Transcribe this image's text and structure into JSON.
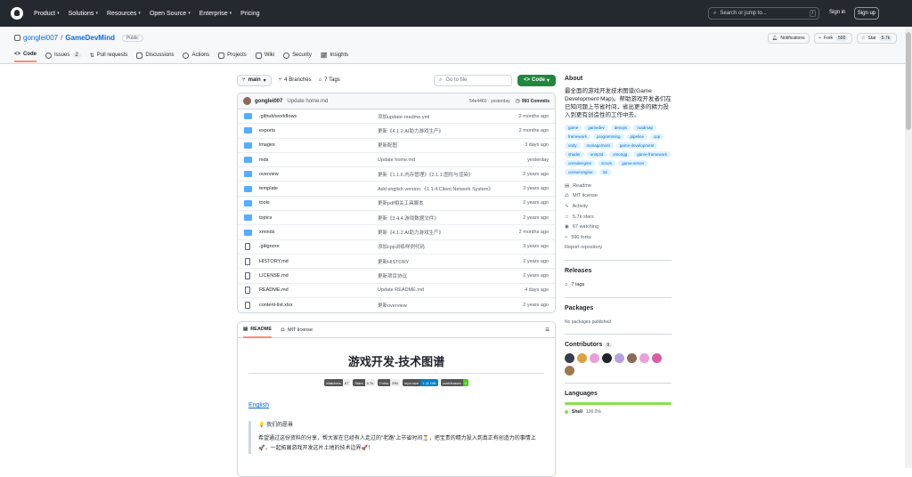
{
  "nav": {
    "items": [
      "Product",
      "Solutions",
      "Resources",
      "Open Source",
      "Enterprise",
      "Pricing"
    ],
    "search_placeholder": "Search or jump to...",
    "search_kbd": "/",
    "signin": "Sign in",
    "signup": "Sign up"
  },
  "repo": {
    "owner": "gonglei007",
    "sep": "/",
    "name": "GameDevMind",
    "visibility": "Public",
    "notifications": "Notifications",
    "fork_label": "Fork",
    "fork_count": "590",
    "star_label": "Star",
    "star_count": "5.7k"
  },
  "tabs": [
    {
      "label": "Code"
    },
    {
      "label": "Issues",
      "count": "2"
    },
    {
      "label": "Pull requests"
    },
    {
      "label": "Discussions"
    },
    {
      "label": "Actions"
    },
    {
      "label": "Projects"
    },
    {
      "label": "Wiki"
    },
    {
      "label": "Security"
    },
    {
      "label": "Insights"
    }
  ],
  "toolbar": {
    "branch": "main",
    "branches": "4 Branches",
    "tags": "7 Tags",
    "goto_placeholder": "Go to file",
    "code_label": "Code"
  },
  "commit": {
    "author": "gonglei007",
    "message": "Update home.md",
    "hash": "54e4460 · yesterday",
    "commits": "993 Commits"
  },
  "files": [
    {
      "type": "dir",
      "name": ".github/workflows",
      "msg": "添加update-readme.yml",
      "date": "2 months ago"
    },
    {
      "type": "dir",
      "name": "exports",
      "msg": "更新《4.1.2.AI助力游戏生产》",
      "date": "2 months ago"
    },
    {
      "type": "dir",
      "name": "images",
      "msg": "更新配图",
      "date": "3 days ago"
    },
    {
      "type": "dir",
      "name": "mds",
      "msg": "Update home.md",
      "date": "yesterday"
    },
    {
      "type": "dir",
      "name": "overview",
      "msg": "更新《1.1.6.内存管理》《2.1.1.图形与渲染》",
      "date": "2 years ago"
    },
    {
      "type": "dir",
      "name": "template",
      "msg": "Add english version 《1.1.4.Client Network System》",
      "date": "3 years ago"
    },
    {
      "type": "dir",
      "name": "tools",
      "msg": "更新pdf相关工具脚本",
      "date": "2 years ago"
    },
    {
      "type": "dir",
      "name": "topics",
      "msg": "更新《3.4.4.游戏数据文件》",
      "date": "2 years ago"
    },
    {
      "type": "dir",
      "name": "xminds",
      "msg": "更新《4.1.2.AI助力游戏生产》",
      "date": "2 months ago"
    },
    {
      "type": "file",
      "name": ".gitignore",
      "msg": "添加cpp训练样例代码",
      "date": "3 years ago"
    },
    {
      "type": "file",
      "name": "HISTORY.md",
      "msg": "更新HISTORY",
      "date": "2 years ago"
    },
    {
      "type": "file",
      "name": "LICENSE.md",
      "msg": "更新项目协议",
      "date": "2 years ago"
    },
    {
      "type": "file",
      "name": "README.md",
      "msg": "Update README.md",
      "date": "4 days ago"
    },
    {
      "type": "file",
      "name": "content-list.xlsx",
      "msg": "更新overview",
      "date": "2 years ago"
    }
  ],
  "readme": {
    "tab_readme": "README",
    "tab_license": "MIT license",
    "title": "游戏开发-技术图谱",
    "badges": [
      {
        "l": "Watchers",
        "r": "67"
      },
      {
        "l": "Stars",
        "r": "5.7k"
      },
      {
        "l": "Forks",
        "r": "590"
      },
      {
        "l": "repo size",
        "r": "1.31 GiB"
      },
      {
        "l": "contributors",
        "r": "9"
      }
    ],
    "english_link": "English",
    "vision": "💡 我们的愿景",
    "vision_text": "希望通过这份资料的分享，帮大家在已经有人走过的\"老路\"上节省时间⏳，把宝贵的精力投入到真正有创造力的事情上🚀，一起拓展游戏开发这片土地的技术边界🚀！"
  },
  "about": {
    "heading": "About",
    "description": "最全面的游戏开发技术图谱(Game Development Map)。帮助游戏开发者们在已知问题上节省时间，省出更多的精力投入到更有创造性的工作中去。",
    "topics": [
      "game",
      "gamedev",
      "devops",
      "roadmap",
      "framework",
      "programming",
      "pipeline",
      "cpp",
      "unity",
      "management",
      "game-development",
      "shader",
      "unity3d",
      "xmongg",
      "game-framework",
      "unrealengine",
      "scrum",
      "game-server",
      "unreal-engine",
      "3d"
    ],
    "links": [
      {
        "icon": "book-icon",
        "label": "Readme"
      },
      {
        "icon": "scale-icon",
        "label": "MIT license"
      },
      {
        "icon": "pulse-icon",
        "label": "Activity"
      },
      {
        "icon": "star-icon",
        "label": "5.7k stars"
      },
      {
        "icon": "eye-icon",
        "label": "67 watching"
      },
      {
        "icon": "fork-icon",
        "label": "590 forks"
      }
    ],
    "report": "Report repository"
  },
  "releases": {
    "heading": "Releases",
    "tags": "7 tags"
  },
  "packages": {
    "heading": "Packages",
    "text": "No packages published"
  },
  "contributors": {
    "heading": "Contributors",
    "count": "9",
    "colors": [
      "#3b3b4f",
      "#d9a441",
      "#e9a0d8",
      "#1f2328",
      "#b6a0e0",
      "#8a6b5a",
      "#e9a0d8",
      "#d85ea8",
      "#a07850"
    ]
  },
  "languages": {
    "heading": "Languages",
    "name": "Shell",
    "pct": "100.0%",
    "color": "#89e051"
  }
}
